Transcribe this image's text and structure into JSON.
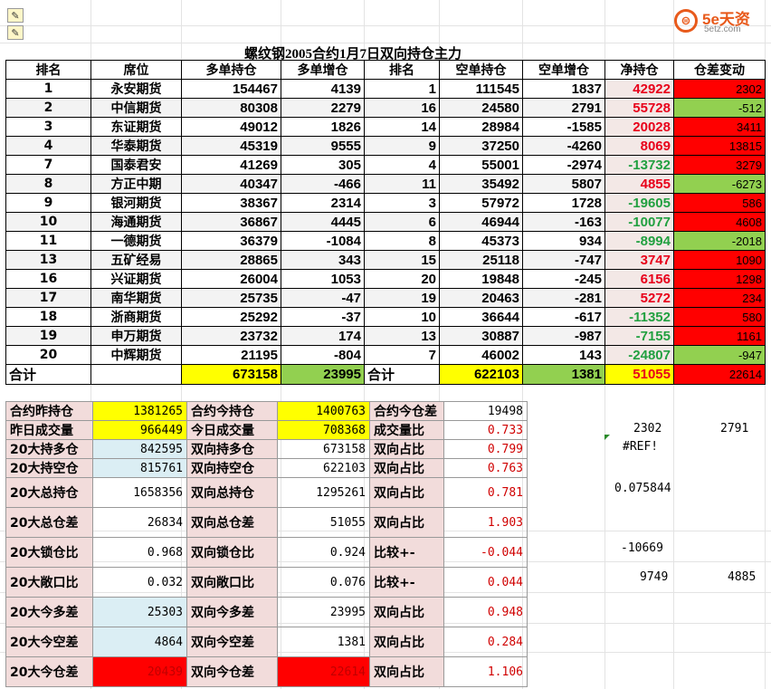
{
  "title": "螺纹钢2005合约1月7日双向持仓主力",
  "logo": {
    "glyph": "⊜",
    "brand": "5e天资",
    "domain": "5etz.com"
  },
  "headers": [
    "排名",
    "席位",
    "多单持仓",
    "多单增仓",
    "排名",
    "空单持仓",
    "空单增仓",
    "净持仓",
    "仓差变动"
  ],
  "rows": [
    {
      "rank": "1",
      "name": "永安期货",
      "long": "154467",
      "long_chg": "4139",
      "srank": "1",
      "short": "111545",
      "short_chg": "1837",
      "net": "42922",
      "diff": "2302"
    },
    {
      "rank": "2",
      "name": "中信期货",
      "long": "80308",
      "long_chg": "2279",
      "srank": "16",
      "short": "24580",
      "short_chg": "2791",
      "net": "55728",
      "diff": "-512"
    },
    {
      "rank": "3",
      "name": "东证期货",
      "long": "49012",
      "long_chg": "1826",
      "srank": "14",
      "short": "28984",
      "short_chg": "-1585",
      "net": "20028",
      "diff": "3411"
    },
    {
      "rank": "4",
      "name": "华泰期货",
      "long": "45319",
      "long_chg": "9555",
      "srank": "9",
      "short": "37250",
      "short_chg": "-4260",
      "net": "8069",
      "diff": "13815"
    },
    {
      "rank": "7",
      "name": "国泰君安",
      "long": "41269",
      "long_chg": "305",
      "srank": "4",
      "short": "55001",
      "short_chg": "-2974",
      "net": "-13732",
      "diff": "3279"
    },
    {
      "rank": "8",
      "name": "方正中期",
      "long": "40347",
      "long_chg": "-466",
      "srank": "11",
      "short": "35492",
      "short_chg": "5807",
      "net": "4855",
      "diff": "-6273"
    },
    {
      "rank": "9",
      "name": "银河期货",
      "long": "38367",
      "long_chg": "2314",
      "srank": "3",
      "short": "57972",
      "short_chg": "1728",
      "net": "-19605",
      "diff": "586"
    },
    {
      "rank": "10",
      "name": "海通期货",
      "long": "36867",
      "long_chg": "4445",
      "srank": "6",
      "short": "46944",
      "short_chg": "-163",
      "net": "-10077",
      "diff": "4608"
    },
    {
      "rank": "11",
      "name": "一德期货",
      "long": "36379",
      "long_chg": "-1084",
      "srank": "8",
      "short": "45373",
      "short_chg": "934",
      "net": "-8994",
      "diff": "-2018"
    },
    {
      "rank": "13",
      "name": "五矿经易",
      "long": "28865",
      "long_chg": "343",
      "srank": "15",
      "short": "25118",
      "short_chg": "-747",
      "net": "3747",
      "diff": "1090"
    },
    {
      "rank": "16",
      "name": "兴证期货",
      "long": "26004",
      "long_chg": "1053",
      "srank": "20",
      "short": "19848",
      "short_chg": "-245",
      "net": "6156",
      "diff": "1298"
    },
    {
      "rank": "17",
      "name": "南华期货",
      "long": "25735",
      "long_chg": "-47",
      "srank": "19",
      "short": "20463",
      "short_chg": "-281",
      "net": "5272",
      "diff": "234"
    },
    {
      "rank": "18",
      "name": "浙商期货",
      "long": "25292",
      "long_chg": "-37",
      "srank": "10",
      "short": "36644",
      "short_chg": "-617",
      "net": "-11352",
      "diff": "580"
    },
    {
      "rank": "19",
      "name": "申万期货",
      "long": "23732",
      "long_chg": "174",
      "srank": "13",
      "short": "30887",
      "short_chg": "-987",
      "net": "-7155",
      "diff": "1161"
    },
    {
      "rank": "20",
      "name": "中辉期货",
      "long": "21195",
      "long_chg": "-804",
      "srank": "7",
      "short": "46002",
      "short_chg": "143",
      "net": "-24807",
      "diff": "-947"
    }
  ],
  "totals": {
    "label": "合计",
    "long": "673158",
    "long_chg": "23995",
    "label2": "合计",
    "short": "622103",
    "short_chg": "1381",
    "net": "51055",
    "diff": "22614"
  },
  "stats": [
    {
      "l1": "合约昨持仓",
      "v1": "1381265",
      "l2": "合约今持仓",
      "v2": "1400763",
      "l3": "合约今仓差",
      "v3": "19498"
    },
    {
      "l1": "昨日成交量",
      "v1": "966449",
      "l2": "今日成交量",
      "v2": "708368",
      "l3": "成交量比",
      "v3": "0.733"
    },
    {
      "l1": "20大持多仓",
      "v1": "842595",
      "l2": "双向持多仓",
      "v2": "673158",
      "l3": "双向占比",
      "v3": "0.799"
    },
    {
      "l1": "20大持空仓",
      "v1": "815761",
      "l2": "双向持空仓",
      "v2": "622103",
      "l3": "双向占比",
      "v3": "0.763"
    },
    {
      "l1": "20大总持仓",
      "v1": "1658356",
      "l2": "双向总持仓",
      "v2": "1295261",
      "l3": "双向占比",
      "v3": "0.781"
    },
    {
      "l1": "20大总仓差",
      "v1": "26834",
      "l2": "双向总仓差",
      "v2": "51055",
      "l3": "双向占比",
      "v3": "1.903"
    },
    {
      "l1": "20大锁仓比",
      "v1": "0.968",
      "l2": "双向锁仓比",
      "v2": "0.924",
      "l3": "比较+-",
      "v3": "-0.044"
    },
    {
      "l1": "20大敞口比",
      "v1": "0.032",
      "l2": "双向敞口比",
      "v2": "0.076",
      "l3": "比较+-",
      "v3": "0.044"
    },
    {
      "l1": "20大今多差",
      "v1": "25303",
      "l2": "双向今多差",
      "v2": "23995",
      "l3": "双向占比",
      "v3": "0.948"
    },
    {
      "l1": "20大今空差",
      "v1": "4864",
      "l2": "双向今空差",
      "v2": "1381",
      "l3": "双向占比",
      "v3": "0.284"
    },
    {
      "l1": "20大今仓差",
      "v1": "20439",
      "l2": "双向今仓差",
      "v2": "22614",
      "l3": "双向占比",
      "v3": "1.106"
    }
  ],
  "extras": {
    "a": "2302",
    "b": "2791",
    "c": "#REF!",
    "d": "0.075844",
    "e": "-10669",
    "f": "9749",
    "g": "4885"
  }
}
